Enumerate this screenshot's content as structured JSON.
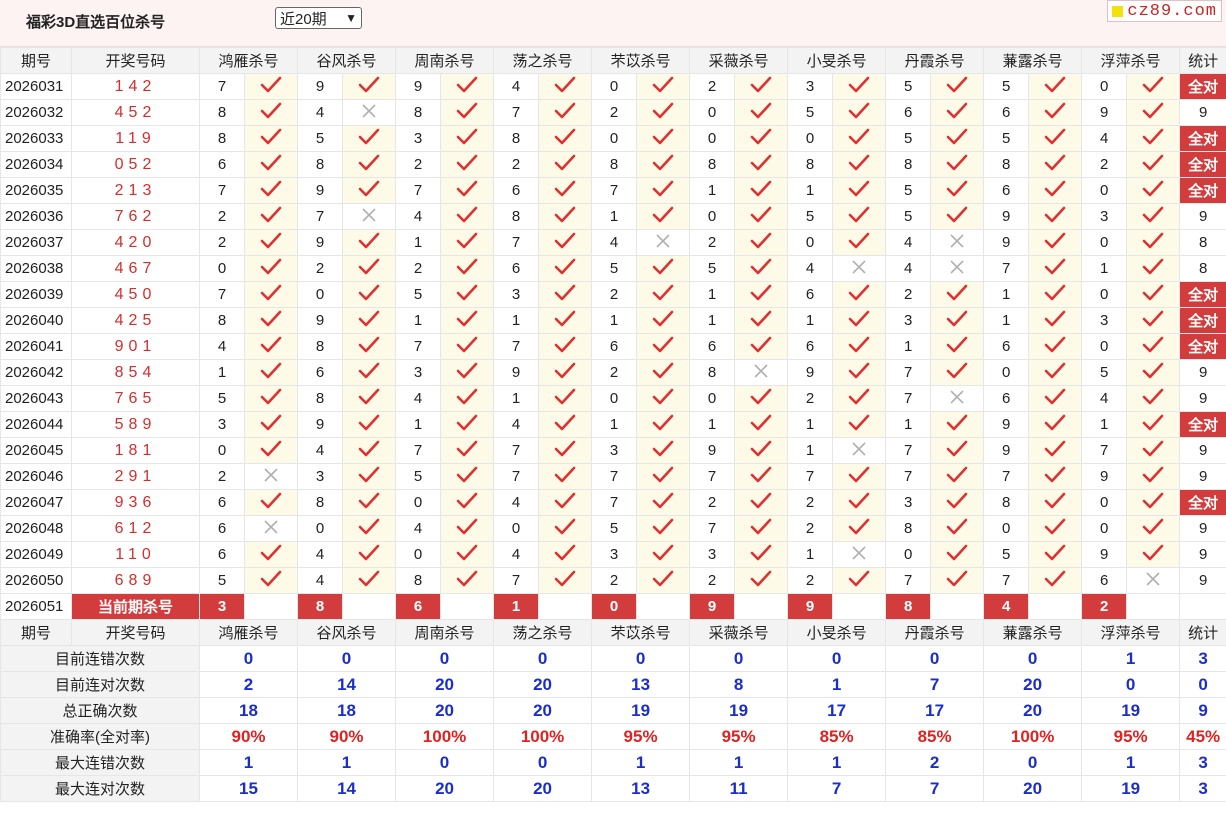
{
  "page": {
    "title": "福彩3D直选百位杀号",
    "period_select": "近20期",
    "logo_text": "cz89.com"
  },
  "header": [
    "期号",
    "开奖号码",
    "鸿雁杀号",
    "谷风杀号",
    "周南杀号",
    "荡之杀号",
    "芣苡杀号",
    "采薇杀号",
    "小旻杀号",
    "丹霞杀号",
    "蒹露杀号",
    "浮萍杀号",
    "统计"
  ],
  "rows": [
    {
      "issue": "2026031",
      "draw": "142",
      "kills": [
        [
          7,
          1
        ],
        [
          9,
          1
        ],
        [
          9,
          1
        ],
        [
          4,
          1
        ],
        [
          0,
          1
        ],
        [
          2,
          1
        ],
        [
          3,
          1
        ],
        [
          5,
          1
        ],
        [
          5,
          1
        ],
        [
          0,
          1
        ]
      ],
      "stat": "全对"
    },
    {
      "issue": "2026032",
      "draw": "452",
      "kills": [
        [
          8,
          1
        ],
        [
          4,
          0
        ],
        [
          8,
          1
        ],
        [
          7,
          1
        ],
        [
          2,
          1
        ],
        [
          0,
          1
        ],
        [
          5,
          1
        ],
        [
          6,
          1
        ],
        [
          6,
          1
        ],
        [
          9,
          1
        ]
      ],
      "stat": "9"
    },
    {
      "issue": "2026033",
      "draw": "119",
      "kills": [
        [
          8,
          1
        ],
        [
          5,
          1
        ],
        [
          3,
          1
        ],
        [
          8,
          1
        ],
        [
          0,
          1
        ],
        [
          0,
          1
        ],
        [
          0,
          1
        ],
        [
          5,
          1
        ],
        [
          5,
          1
        ],
        [
          4,
          1
        ]
      ],
      "stat": "全对"
    },
    {
      "issue": "2026034",
      "draw": "052",
      "kills": [
        [
          6,
          1
        ],
        [
          8,
          1
        ],
        [
          2,
          1
        ],
        [
          2,
          1
        ],
        [
          8,
          1
        ],
        [
          8,
          1
        ],
        [
          8,
          1
        ],
        [
          8,
          1
        ],
        [
          8,
          1
        ],
        [
          2,
          1
        ]
      ],
      "stat": "全对"
    },
    {
      "issue": "2026035",
      "draw": "213",
      "kills": [
        [
          7,
          1
        ],
        [
          9,
          1
        ],
        [
          7,
          1
        ],
        [
          6,
          1
        ],
        [
          7,
          1
        ],
        [
          1,
          1
        ],
        [
          1,
          1
        ],
        [
          5,
          1
        ],
        [
          6,
          1
        ],
        [
          0,
          1
        ]
      ],
      "stat": "全对"
    },
    {
      "issue": "2026036",
      "draw": "762",
      "kills": [
        [
          2,
          1
        ],
        [
          7,
          0
        ],
        [
          4,
          1
        ],
        [
          8,
          1
        ],
        [
          1,
          1
        ],
        [
          0,
          1
        ],
        [
          5,
          1
        ],
        [
          5,
          1
        ],
        [
          9,
          1
        ],
        [
          3,
          1
        ]
      ],
      "stat": "9"
    },
    {
      "issue": "2026037",
      "draw": "420",
      "kills": [
        [
          2,
          1
        ],
        [
          9,
          1
        ],
        [
          1,
          1
        ],
        [
          7,
          1
        ],
        [
          4,
          0
        ],
        [
          2,
          1
        ],
        [
          0,
          1
        ],
        [
          4,
          0
        ],
        [
          9,
          1
        ],
        [
          0,
          1
        ]
      ],
      "stat": "8"
    },
    {
      "issue": "2026038",
      "draw": "467",
      "kills": [
        [
          0,
          1
        ],
        [
          2,
          1
        ],
        [
          2,
          1
        ],
        [
          6,
          1
        ],
        [
          5,
          1
        ],
        [
          5,
          1
        ],
        [
          4,
          0
        ],
        [
          4,
          0
        ],
        [
          7,
          1
        ],
        [
          1,
          1
        ]
      ],
      "stat": "8"
    },
    {
      "issue": "2026039",
      "draw": "450",
      "kills": [
        [
          7,
          1
        ],
        [
          0,
          1
        ],
        [
          5,
          1
        ],
        [
          3,
          1
        ],
        [
          2,
          1
        ],
        [
          1,
          1
        ],
        [
          6,
          1
        ],
        [
          2,
          1
        ],
        [
          1,
          1
        ],
        [
          0,
          1
        ]
      ],
      "stat": "全对"
    },
    {
      "issue": "2026040",
      "draw": "425",
      "kills": [
        [
          8,
          1
        ],
        [
          9,
          1
        ],
        [
          1,
          1
        ],
        [
          1,
          1
        ],
        [
          1,
          1
        ],
        [
          1,
          1
        ],
        [
          1,
          1
        ],
        [
          3,
          1
        ],
        [
          1,
          1
        ],
        [
          3,
          1
        ]
      ],
      "stat": "全对"
    },
    {
      "issue": "2026041",
      "draw": "901",
      "kills": [
        [
          4,
          1
        ],
        [
          8,
          1
        ],
        [
          7,
          1
        ],
        [
          7,
          1
        ],
        [
          6,
          1
        ],
        [
          6,
          1
        ],
        [
          6,
          1
        ],
        [
          1,
          1
        ],
        [
          6,
          1
        ],
        [
          0,
          1
        ]
      ],
      "stat": "全对"
    },
    {
      "issue": "2026042",
      "draw": "854",
      "kills": [
        [
          1,
          1
        ],
        [
          6,
          1
        ],
        [
          3,
          1
        ],
        [
          9,
          1
        ],
        [
          2,
          1
        ],
        [
          8,
          0
        ],
        [
          9,
          1
        ],
        [
          7,
          1
        ],
        [
          0,
          1
        ],
        [
          5,
          1
        ]
      ],
      "stat": "9"
    },
    {
      "issue": "2026043",
      "draw": "765",
      "kills": [
        [
          5,
          1
        ],
        [
          8,
          1
        ],
        [
          4,
          1
        ],
        [
          1,
          1
        ],
        [
          0,
          1
        ],
        [
          0,
          1
        ],
        [
          2,
          1
        ],
        [
          7,
          0
        ],
        [
          6,
          1
        ],
        [
          4,
          1
        ]
      ],
      "stat": "9"
    },
    {
      "issue": "2026044",
      "draw": "589",
      "kills": [
        [
          3,
          1
        ],
        [
          9,
          1
        ],
        [
          1,
          1
        ],
        [
          4,
          1
        ],
        [
          1,
          1
        ],
        [
          1,
          1
        ],
        [
          1,
          1
        ],
        [
          1,
          1
        ],
        [
          9,
          1
        ],
        [
          1,
          1
        ]
      ],
      "stat": "全对"
    },
    {
      "issue": "2026045",
      "draw": "181",
      "kills": [
        [
          0,
          1
        ],
        [
          4,
          1
        ],
        [
          7,
          1
        ],
        [
          7,
          1
        ],
        [
          3,
          1
        ],
        [
          9,
          1
        ],
        [
          1,
          0
        ],
        [
          7,
          1
        ],
        [
          9,
          1
        ],
        [
          7,
          1
        ]
      ],
      "stat": "9"
    },
    {
      "issue": "2026046",
      "draw": "291",
      "kills": [
        [
          2,
          0
        ],
        [
          3,
          1
        ],
        [
          5,
          1
        ],
        [
          7,
          1
        ],
        [
          7,
          1
        ],
        [
          7,
          1
        ],
        [
          7,
          1
        ],
        [
          7,
          1
        ],
        [
          7,
          1
        ],
        [
          9,
          1
        ]
      ],
      "stat": "9"
    },
    {
      "issue": "2026047",
      "draw": "936",
      "kills": [
        [
          6,
          1
        ],
        [
          8,
          1
        ],
        [
          0,
          1
        ],
        [
          4,
          1
        ],
        [
          7,
          1
        ],
        [
          2,
          1
        ],
        [
          2,
          1
        ],
        [
          3,
          1
        ],
        [
          8,
          1
        ],
        [
          0,
          1
        ]
      ],
      "stat": "全对"
    },
    {
      "issue": "2026048",
      "draw": "612",
      "kills": [
        [
          6,
          0
        ],
        [
          0,
          1
        ],
        [
          4,
          1
        ],
        [
          0,
          1
        ],
        [
          5,
          1
        ],
        [
          7,
          1
        ],
        [
          2,
          1
        ],
        [
          8,
          1
        ],
        [
          0,
          1
        ],
        [
          0,
          1
        ]
      ],
      "stat": "9"
    },
    {
      "issue": "2026049",
      "draw": "110",
      "kills": [
        [
          6,
          1
        ],
        [
          4,
          1
        ],
        [
          0,
          1
        ],
        [
          4,
          1
        ],
        [
          3,
          1
        ],
        [
          3,
          1
        ],
        [
          1,
          0
        ],
        [
          0,
          1
        ],
        [
          5,
          1
        ],
        [
          9,
          1
        ]
      ],
      "stat": "9"
    },
    {
      "issue": "2026050",
      "draw": "689",
      "kills": [
        [
          5,
          1
        ],
        [
          4,
          1
        ],
        [
          8,
          1
        ],
        [
          7,
          1
        ],
        [
          2,
          1
        ],
        [
          2,
          1
        ],
        [
          2,
          1
        ],
        [
          7,
          1
        ],
        [
          7,
          1
        ],
        [
          6,
          0
        ]
      ],
      "stat": "9"
    }
  ],
  "current": {
    "issue": "2026051",
    "label": "当前期杀号",
    "kills": [
      "3",
      "8",
      "6",
      "1",
      "0",
      "9",
      "9",
      "8",
      "4",
      "2"
    ]
  },
  "stats": [
    {
      "label": "目前连错次数",
      "values": [
        "0",
        "0",
        "0",
        "0",
        "0",
        "0",
        "0",
        "0",
        "0",
        "1"
      ],
      "total": "3",
      "rate": false
    },
    {
      "label": "目前连对次数",
      "values": [
        "2",
        "14",
        "20",
        "20",
        "13",
        "8",
        "1",
        "7",
        "20",
        "0"
      ],
      "total": "0",
      "rate": false
    },
    {
      "label": "总正确次数",
      "values": [
        "18",
        "18",
        "20",
        "20",
        "19",
        "19",
        "17",
        "17",
        "20",
        "19"
      ],
      "total": "9",
      "rate": false
    },
    {
      "label": "准确率(全对率)",
      "values": [
        "90%",
        "90%",
        "100%",
        "100%",
        "95%",
        "95%",
        "85%",
        "85%",
        "100%",
        "95%"
      ],
      "total": "45%",
      "rate": true
    },
    {
      "label": "最大连错次数",
      "values": [
        "1",
        "1",
        "0",
        "0",
        "1",
        "1",
        "1",
        "2",
        "0",
        "1"
      ],
      "total": "3",
      "rate": false
    },
    {
      "label": "最大连对次数",
      "values": [
        "15",
        "14",
        "20",
        "20",
        "13",
        "11",
        "7",
        "7",
        "20",
        "19"
      ],
      "total": "3",
      "rate": false
    }
  ],
  "colors": {
    "accent_red": "#d23c3c",
    "check_red": "#e03030",
    "cross_gray": "#b0b0b0",
    "stat_blue": "#1b2fc8",
    "rate_red": "#e02222",
    "mark_bg": "#fdfbe8"
  },
  "icons": {
    "correct": "check-icon",
    "wrong": "cross-icon"
  }
}
